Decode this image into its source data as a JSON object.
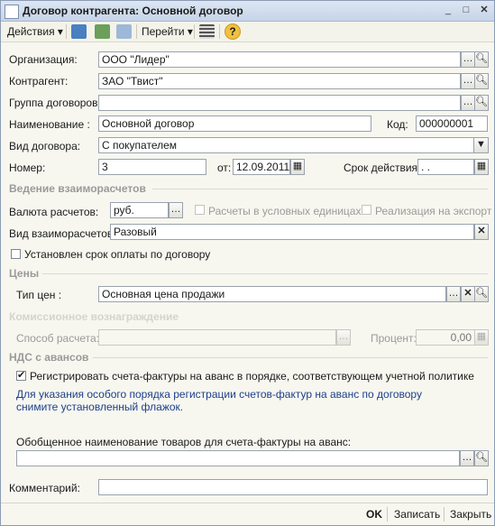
{
  "window": {
    "title": "Договор контрагента: Основной договор"
  },
  "toolbar": {
    "actions_label": "Действия",
    "goto_label": "Перейти",
    "help": "?"
  },
  "fields": {
    "org_label": "Организация:",
    "org_value": "ООО \"Лидер\"",
    "contractor_label": "Контрагент:",
    "contractor_value": "ЗАО \"Твист\"",
    "group_label": "Группа договоров:",
    "group_value": "",
    "name_label": "Наименование :",
    "name_value": "Основной договор",
    "code_label": "Код:",
    "code_value": "000000001",
    "type_label": "Вид договора:",
    "type_value": "С покупателем",
    "number_label": "Номер:",
    "number_value": "3",
    "from_label": "от:",
    "date_value": "12.09.2011",
    "validity_label": "Срок действия:",
    "validity_value": ". ."
  },
  "settlements": {
    "section": "Ведение взаиморасчетов",
    "currency_label": "Валюта расчетов:",
    "currency_value": "руб.",
    "conv_units_label": "Расчеты в условных единицах",
    "export_label": "Реализация на экспорт",
    "kind_label": "Вид взаиморасчетов:",
    "kind_value": "Разовый",
    "term_label": "Установлен срок оплаты по договору"
  },
  "prices": {
    "section": "Цены",
    "price_type_label": "Тип цен :",
    "price_type_value": "Основная цена продажи"
  },
  "commission": {
    "section": "Комиссионное вознаграждение",
    "method_label": "Способ расчета:",
    "method_value": "",
    "percent_label": "Процент:",
    "percent_value": "0,00"
  },
  "vat": {
    "section": "НДС с авансов",
    "register_label": "Регистрировать счета-фактуры на аванс в порядке, соответствующем учетной политике",
    "info_text": "Для указания особого порядка регистрации счетов-фактур на аванс по договору снимите установленный флажок.",
    "generalized_label": "Обобщенное наименование товаров для счета-фактуры на аванс:",
    "generalized_value": ""
  },
  "comment": {
    "label": "Комментарий:",
    "value": ""
  },
  "footer": {
    "ok": "OK",
    "save": "Записать",
    "close": "Закрыть"
  }
}
